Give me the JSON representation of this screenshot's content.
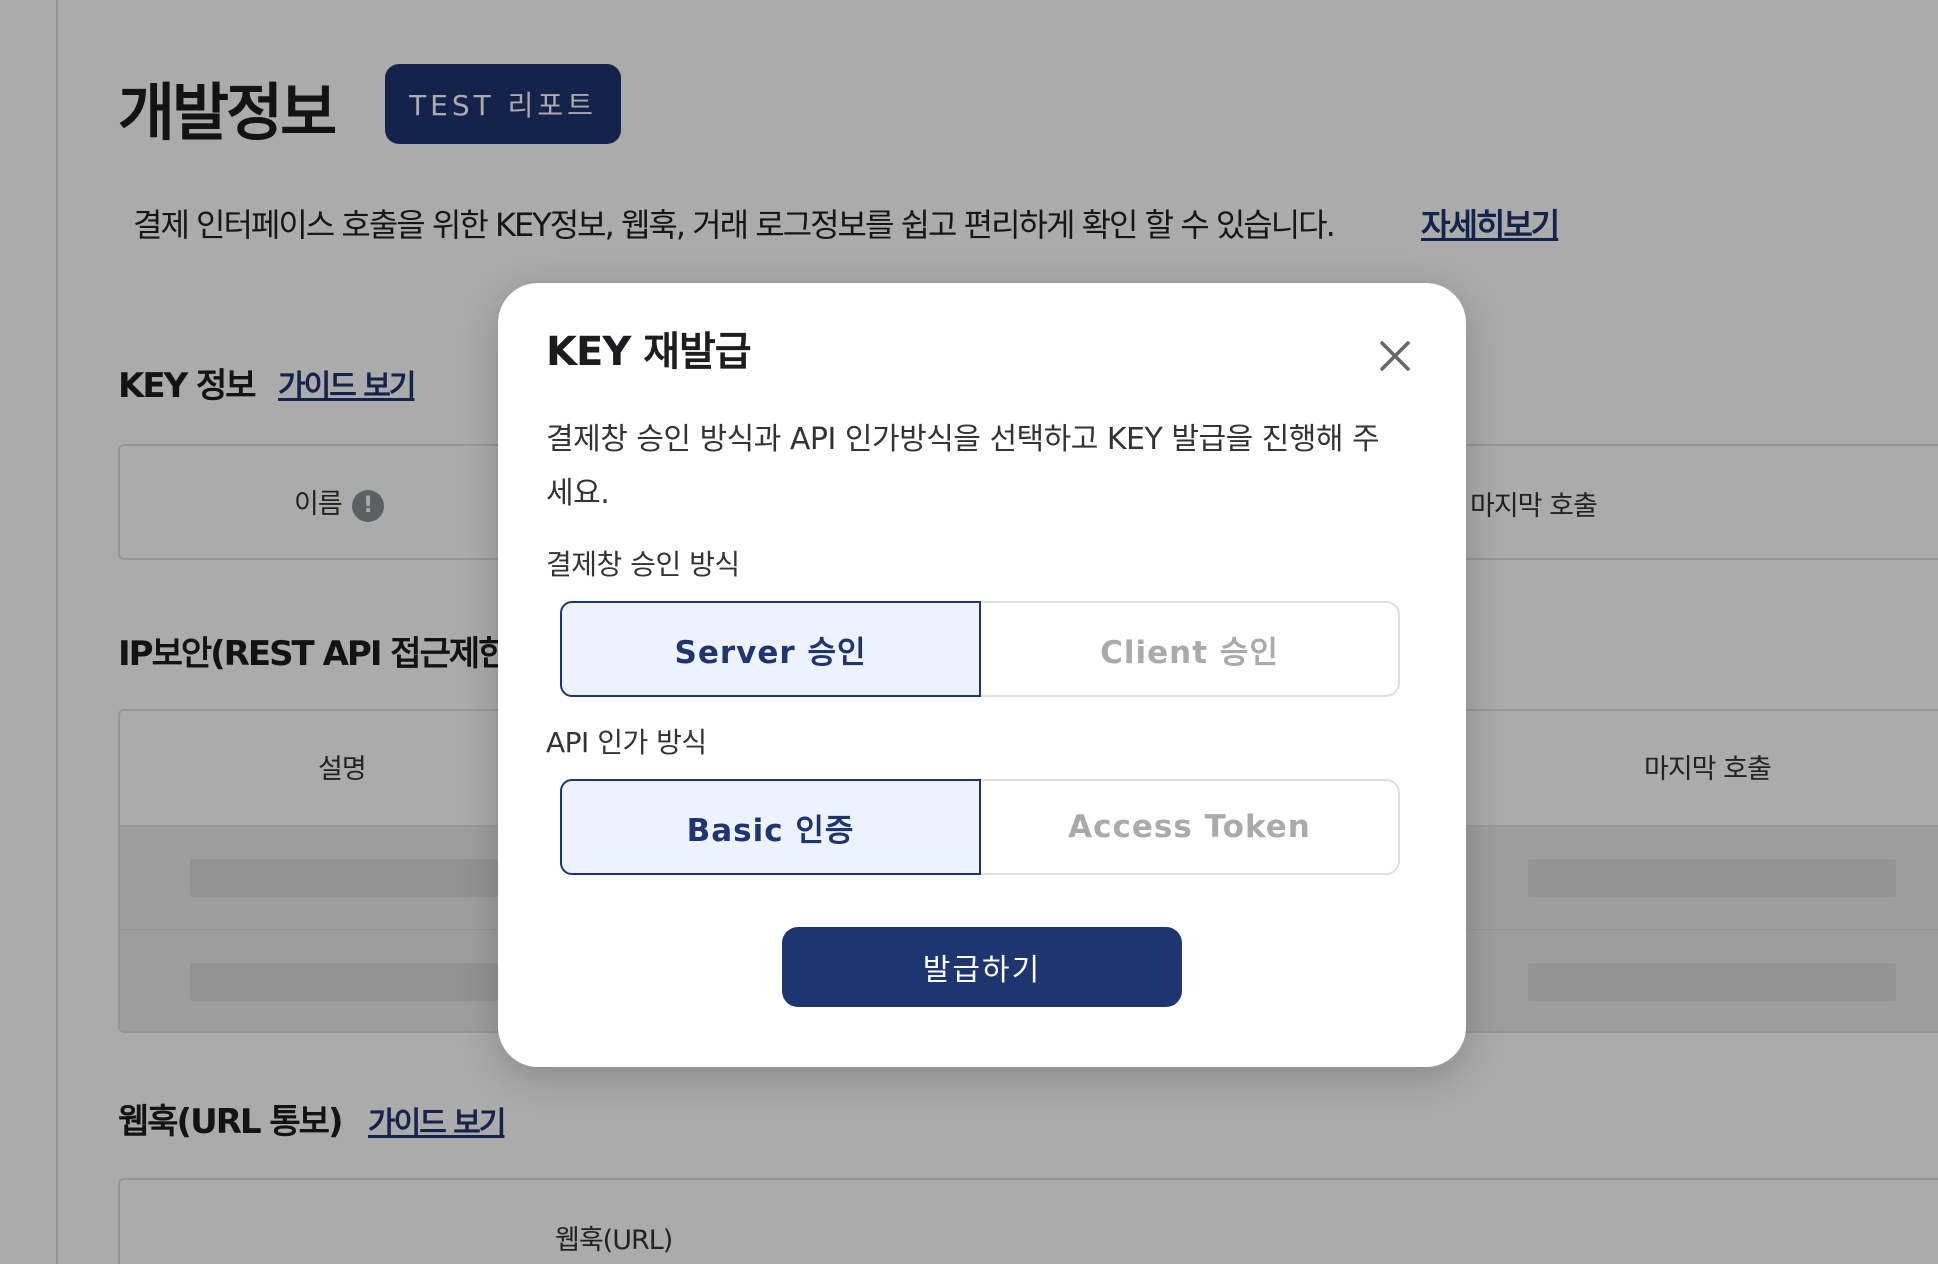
{
  "page": {
    "title": "개발정보",
    "test_report_button": "TEST 리포트",
    "description": "결제 인터페이스 호출을 위한 KEY정보, 웹훅, 거래 로그정보를 쉽고 편리하게 확인 할 수 있습니다.",
    "detail_link": "자세히보기"
  },
  "key_section": {
    "title": "KEY 정보",
    "guide_link": "가이드 보기",
    "col_name": "이름",
    "col_last_call": "마지막 호출"
  },
  "ip_section": {
    "title": "IP보안(REST API 접근제한",
    "col_desc": "설명",
    "col_last_call": "마지막 호출"
  },
  "webhook_section": {
    "title": "웹훅(URL 통보)",
    "guide_link": "가이드 보기",
    "col_url": "웹훅(URL)"
  },
  "modal": {
    "title": "KEY 재발급",
    "description": "결제창 승인 방식과 API 인가방식을 선택하고 KEY 발급을 진행해 주세요.",
    "approval_label": "결제창 승인 방식",
    "approval_options": [
      "Server 승인",
      "Client 승인"
    ],
    "approval_selected": "Server 승인",
    "auth_label": "API 인가 방식",
    "auth_options": [
      "Basic 인증",
      "Access Token"
    ],
    "auth_selected": "Basic 인증",
    "issue_button": "발급하기"
  },
  "colors": {
    "brand_navy": "#1f3570",
    "selected_bg": "#edf2fc",
    "overlay": "rgba(0,0,0,0.33)"
  },
  "icons": {
    "info": "info-icon",
    "close": "close-icon"
  }
}
